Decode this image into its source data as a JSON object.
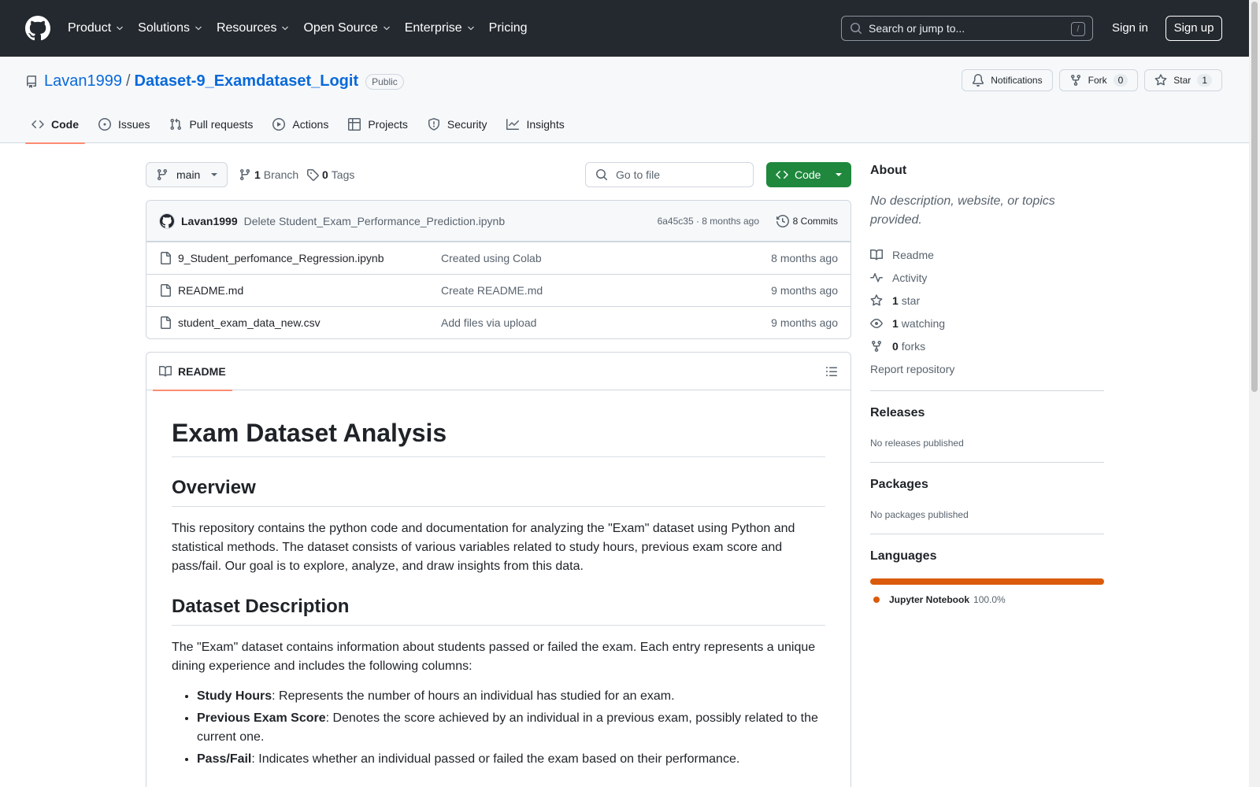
{
  "header": {
    "nav": [
      "Product",
      "Solutions",
      "Resources",
      "Open Source",
      "Enterprise",
      "Pricing"
    ],
    "search_placeholder": "Search or jump to...",
    "search_shortcut": "/",
    "sign_in": "Sign in",
    "sign_up": "Sign up"
  },
  "repo": {
    "owner": "Lavan1999",
    "separator": "/",
    "name": "Dataset-9_Examdataset_Logit",
    "visibility": "Public",
    "notifications_label": "Notifications",
    "fork_label": "Fork",
    "fork_count": "0",
    "star_label": "Star",
    "star_count": "1"
  },
  "tabs": [
    {
      "label": "Code",
      "icon": "code-icon"
    },
    {
      "label": "Issues",
      "icon": "issue-icon"
    },
    {
      "label": "Pull requests",
      "icon": "pull-request-icon"
    },
    {
      "label": "Actions",
      "icon": "play-icon"
    },
    {
      "label": "Projects",
      "icon": "table-icon"
    },
    {
      "label": "Security",
      "icon": "shield-icon"
    },
    {
      "label": "Insights",
      "icon": "graph-icon"
    }
  ],
  "file_nav": {
    "branch": "main",
    "branch_count": "1",
    "branch_label": "Branch",
    "tag_count": "0",
    "tag_label": "Tags",
    "goto_placeholder": "Go to file",
    "code_button": "Code"
  },
  "commit": {
    "author": "Lavan1999",
    "message": "Delete Student_Exam_Performance_Prediction.ipynb",
    "hash_age": "6a45c35 · 8 months ago",
    "commits": "8 Commits"
  },
  "files": [
    {
      "name": "9_Student_perfomance_Regression.ipynb",
      "message": "Created using Colab",
      "age": "8 months ago"
    },
    {
      "name": "README.md",
      "message": "Create README.md",
      "age": "9 months ago"
    },
    {
      "name": "student_exam_data_new.csv",
      "message": "Add files via upload",
      "age": "9 months ago"
    }
  ],
  "readme": {
    "tab_label": "README",
    "h1": "Exam Dataset Analysis",
    "overview_h": "Overview",
    "overview_p": "This repository contains the python code and documentation for analyzing the \"Exam\" dataset using Python and statistical methods. The dataset consists of various variables related to study hours, previous exam score and pass/fail. Our goal is to explore, analyze, and draw insights from this data.",
    "desc_h": "Dataset Description",
    "desc_p": "The \"Exam\" dataset contains information about students passed or failed the exam. Each entry represents a unique dining experience and includes the following columns:",
    "items": [
      {
        "term": "Study Hours",
        "text": ": Represents the number of hours an individual has studied for an exam."
      },
      {
        "term": "Previous Exam Score",
        "text": ": Denotes the score achieved by an individual in a previous exam, possibly related to the current one."
      },
      {
        "term": "Pass/Fail",
        "text": ": Indicates whether an individual passed or failed the exam based on their performance."
      }
    ]
  },
  "sidebar": {
    "about_h": "About",
    "about_desc": "No description, website, or topics provided.",
    "readme_link": "Readme",
    "activity_link": "Activity",
    "stars_count": "1",
    "stars_label": "star",
    "watching_count": "1",
    "watching_label": "watching",
    "forks_count": "0",
    "forks_label": "forks",
    "report": "Report repository",
    "releases_h": "Releases",
    "releases_sub": "No releases published",
    "packages_h": "Packages",
    "packages_sub": "No packages published",
    "languages_h": "Languages",
    "language_name": "Jupyter Notebook",
    "language_pct": "100.0%",
    "language_color": "#da5b0b"
  }
}
